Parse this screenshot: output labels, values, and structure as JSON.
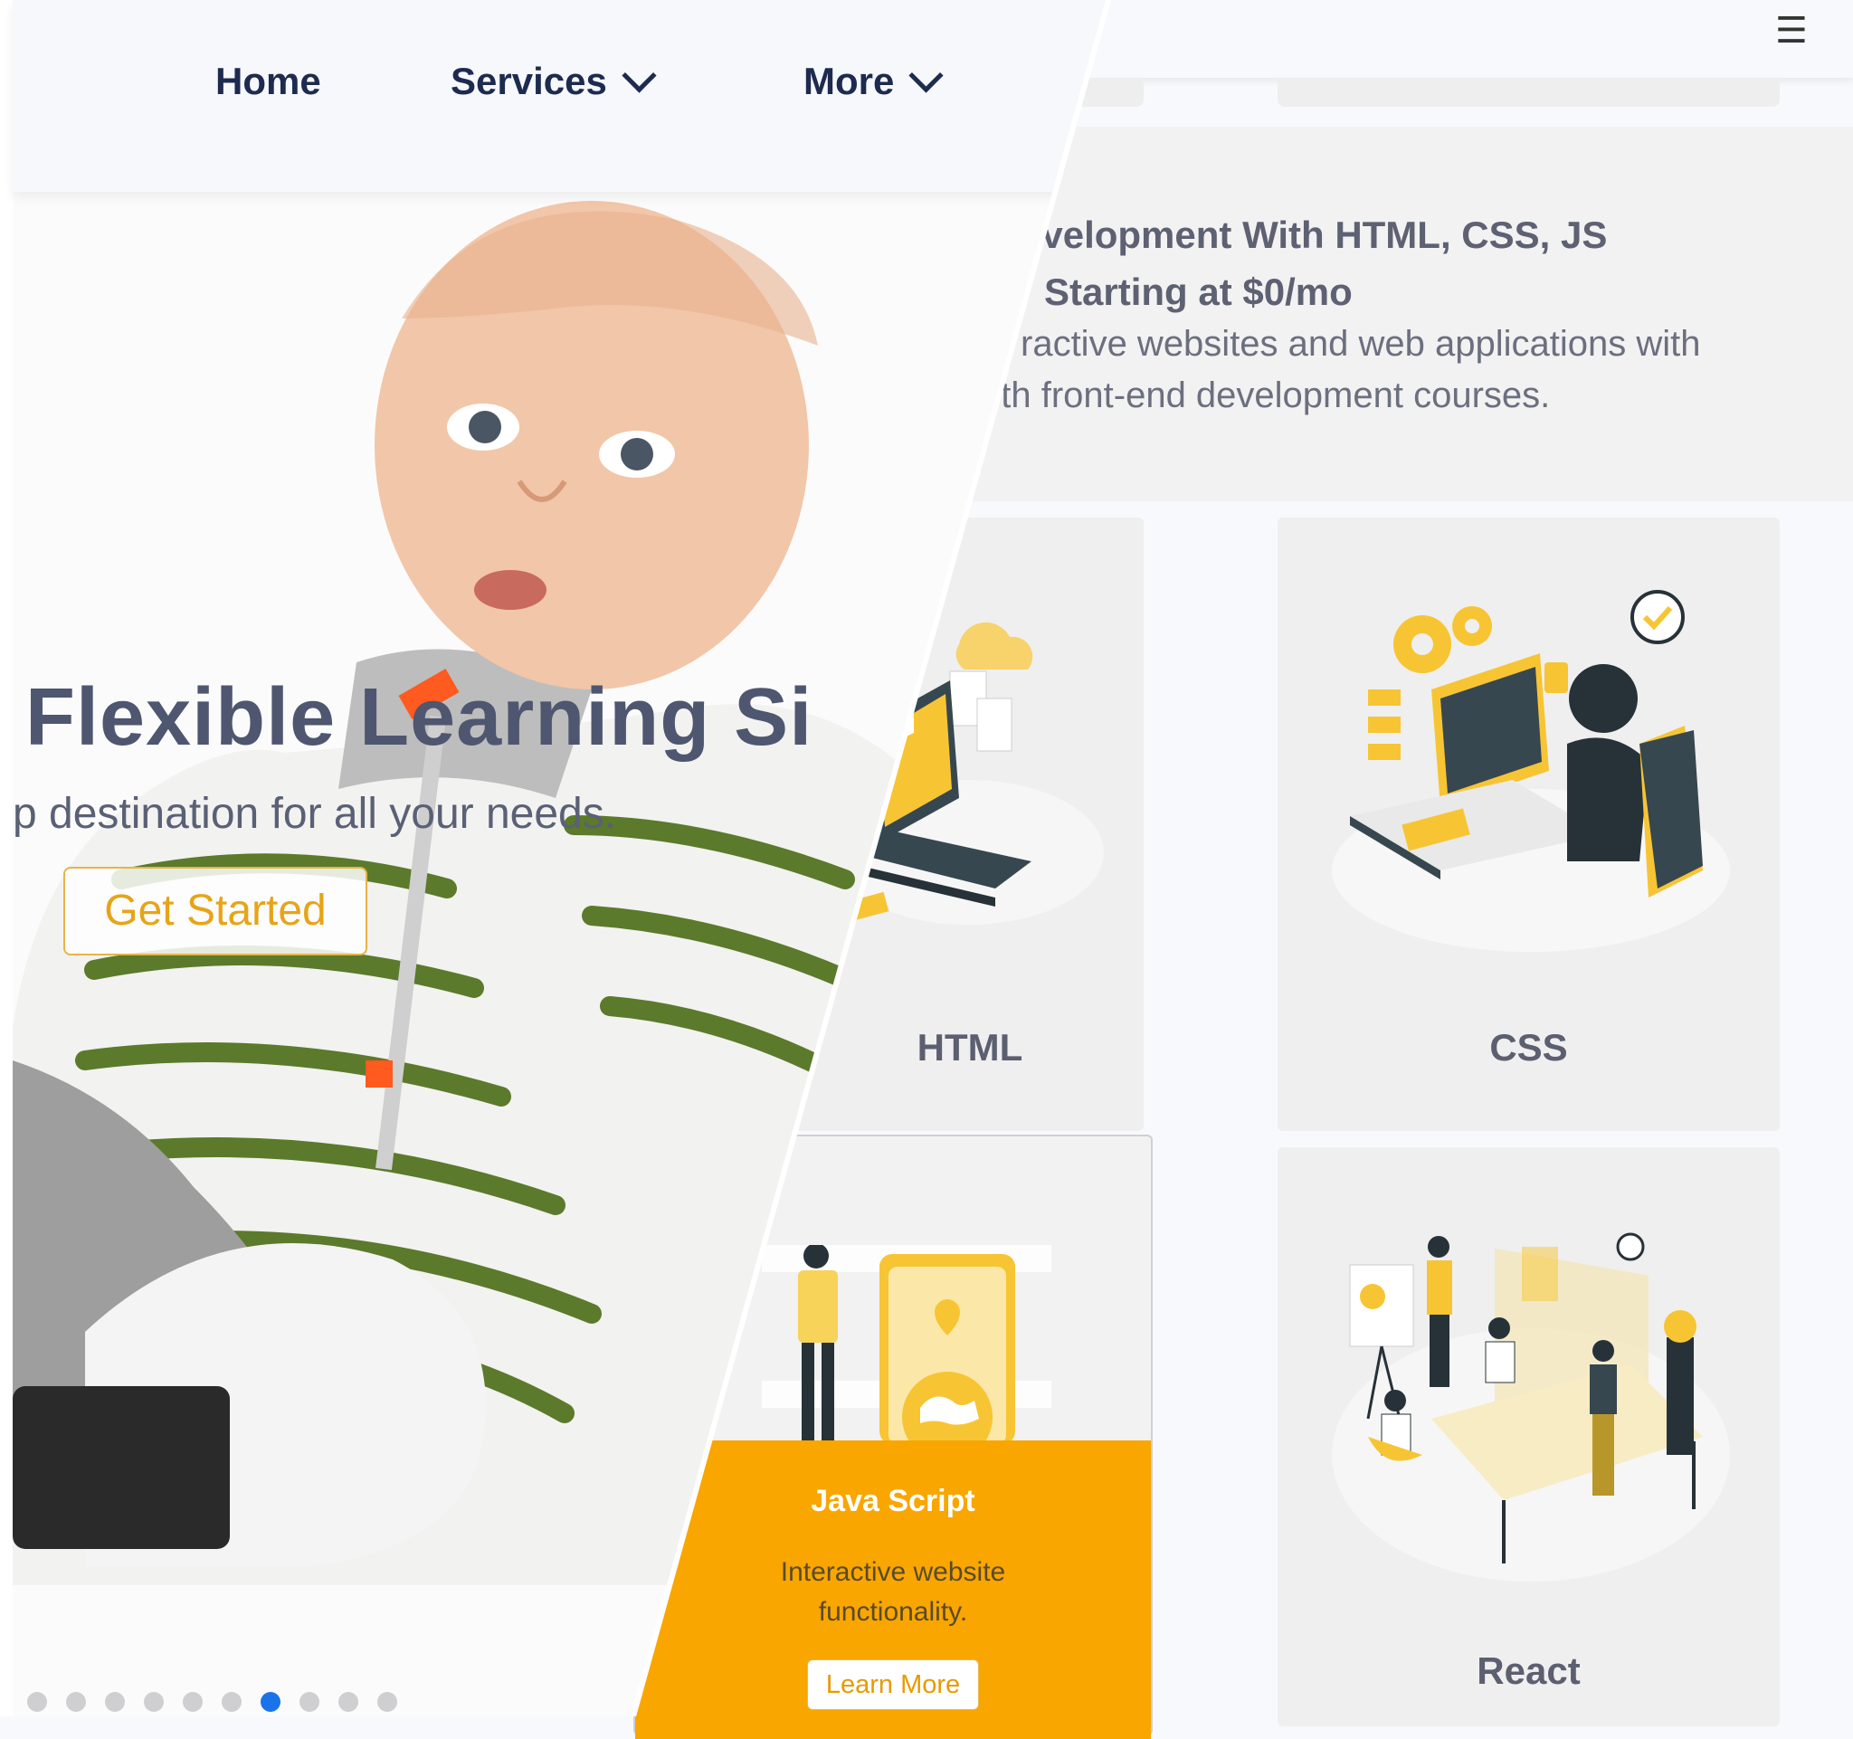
{
  "right_panel": {
    "menu_icon": "hamburger-icon",
    "promo": {
      "title_line1": "evelopment With HTML, CSS, JS",
      "title_line2": "Starting at $0/mo",
      "text_line1": "ractive websites and web applications with",
      "text_line2": "pth front-end development courses."
    },
    "cards": {
      "html": {
        "title": "HTML"
      },
      "css": {
        "title": "CSS"
      },
      "react": {
        "title": "React"
      },
      "js": {
        "title": "Java Script",
        "description_line1": "Interactive website",
        "description_line2": "functionality.",
        "button_label": "Learn More"
      }
    },
    "colors": {
      "accent": "#f9a600",
      "card_bg": "#efefef",
      "text": "#5b5f70"
    }
  },
  "left_panel": {
    "nav": {
      "home": "Home",
      "services": "Services",
      "more": "More"
    },
    "hero": {
      "title": "Flexible Learning Si",
      "subtitle": "p destination for all your needs.",
      "button_label": "Get Started"
    },
    "carousel": {
      "total_slides": 10,
      "active_slide": 7
    },
    "colors": {
      "button_border": "#e7b447",
      "button_text": "#e7a418",
      "active_dot": "#1a73e8"
    }
  }
}
